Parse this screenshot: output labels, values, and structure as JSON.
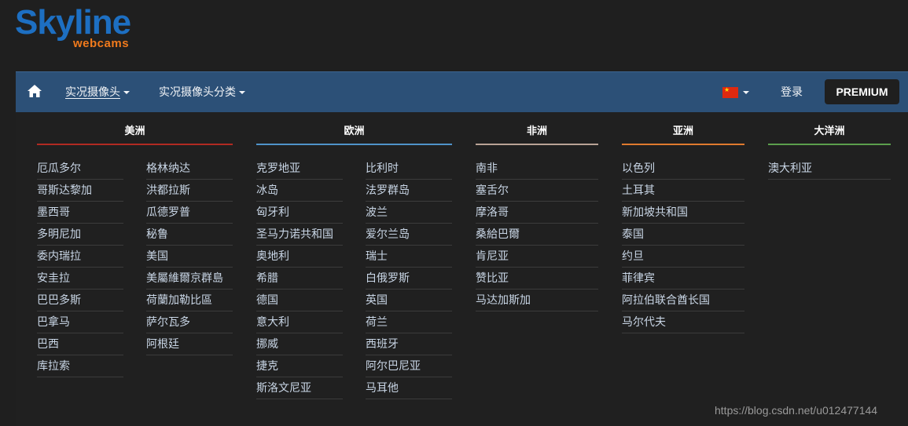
{
  "logo": {
    "main": "Skyline",
    "sub": "webcams"
  },
  "nav": {
    "menu_live": "实况摄像头",
    "menu_categories": "实况摄像头分类",
    "login": "登录",
    "premium": "PREMIUM",
    "language_flag": "china-flag-icon"
  },
  "colors": {
    "navbar": "#2c5077",
    "america_line": "#b02a22",
    "europe_line": "#4f93c9",
    "africa_line": "#b9a396",
    "asia_line": "#e07a2e",
    "oceania_line": "#5b9f4c"
  },
  "regions": {
    "america": {
      "title": "美洲",
      "col1": [
        "厄瓜多尔",
        "哥斯达黎加",
        "墨西哥",
        "多明尼加",
        "委内瑞拉",
        "安圭拉",
        "巴巴多斯",
        "巴拿马",
        "巴西",
        "库拉索"
      ],
      "col2": [
        "格林纳达",
        "洪都拉斯",
        "瓜德罗普",
        "秘鲁",
        "美国",
        "美屬維爾京群島",
        "荷蘭加勒比區",
        "萨尔瓦多",
        "阿根廷"
      ]
    },
    "europe": {
      "title": "欧洲",
      "col1": [
        "克罗地亚",
        "冰岛",
        "匈牙利",
        "圣马力诺共和国",
        "奥地利",
        "希腊",
        "德国",
        "意大利",
        "挪威",
        "捷克",
        "斯洛文尼亚"
      ],
      "col2": [
        "比利时",
        "法罗群岛",
        "波兰",
        "爱尔兰岛",
        "瑞士",
        "白俄罗斯",
        "英国",
        "荷兰",
        "西班牙",
        "阿尔巴尼亚",
        "马耳他"
      ]
    },
    "africa": {
      "title": "非洲",
      "col1": [
        "南非",
        "塞舌尔",
        "摩洛哥",
        "桑給巴爾",
        "肯尼亚",
        "赞比亚",
        "马达加斯加"
      ]
    },
    "asia": {
      "title": "亚洲",
      "col1": [
        "以色列",
        "土耳其",
        "新加坡共和国",
        "泰国",
        "约旦",
        "菲律宾",
        "阿拉伯联合酋长国",
        "马尔代夫"
      ]
    },
    "oceania": {
      "title": "大洋洲",
      "col1": [
        "澳大利亚"
      ]
    }
  },
  "watermark": "https://blog.csdn.net/u012477144"
}
